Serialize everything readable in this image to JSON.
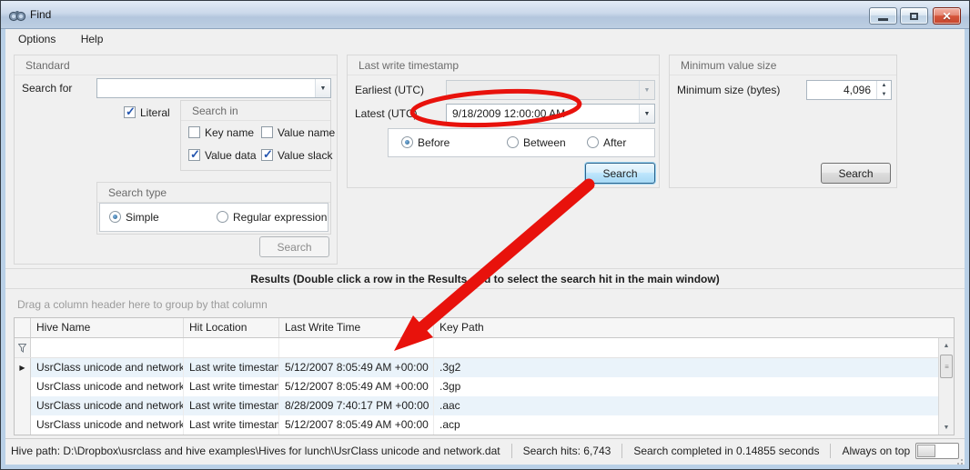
{
  "window": {
    "title": "Find"
  },
  "menu": {
    "options": "Options",
    "help": "Help"
  },
  "standard_group": {
    "title": "Standard",
    "search_for_label": "Search for",
    "search_for_value": "",
    "literal": {
      "label": "Literal",
      "checked": true
    },
    "search_in": {
      "title": "Search in",
      "options": [
        {
          "label": "Key name",
          "checked": false
        },
        {
          "label": "Value name",
          "checked": false
        },
        {
          "label": "Value data",
          "checked": true
        },
        {
          "label": "Value slack",
          "checked": true
        }
      ]
    },
    "search_type": {
      "title": "Search type",
      "options": [
        {
          "label": "Simple",
          "selected": true
        },
        {
          "label": "Regular expression",
          "selected": false
        }
      ]
    },
    "search_button": "Search"
  },
  "timestamp_group": {
    "title": "Last write timestamp",
    "earliest_label": "Earliest (UTC)",
    "earliest_value": "",
    "latest_label": "Latest (UTC)",
    "latest_value": "9/18/2009 12:00:00 AM",
    "range_options": [
      {
        "label": "Before",
        "selected": true
      },
      {
        "label": "Between",
        "selected": false
      },
      {
        "label": "After",
        "selected": false
      }
    ],
    "search_button": "Search"
  },
  "minsize_group": {
    "title": "Minimum value size",
    "size_label": "Minimum size (bytes)",
    "size_value": "4,096",
    "search_button": "Search"
  },
  "results": {
    "header": "Results (Double click a row in the Results grid to select the search hit in the main window)",
    "drag_hint": "Drag a column header here to group by that column",
    "columns": [
      "Hive Name",
      "Hit Location",
      "Last Write Time",
      "Key Path"
    ],
    "rows": [
      {
        "hive": "UsrClass unicode and network.dat",
        "hit": "Last write timestamp",
        "time": "5/12/2007 8:05:49 AM +00:00",
        "path": ".3g2",
        "selected": true
      },
      {
        "hive": "UsrClass unicode and network.dat",
        "hit": "Last write timestamp",
        "time": "5/12/2007 8:05:49 AM +00:00",
        "path": ".3gp",
        "selected": false
      },
      {
        "hive": "UsrClass unicode and network.dat",
        "hit": "Last write timestamp",
        "time": "8/28/2009 7:40:17 PM +00:00",
        "path": ".aac",
        "selected": false
      },
      {
        "hive": "UsrClass unicode and network.dat",
        "hit": "Last write timestamp",
        "time": "5/12/2007 8:05:49 AM +00:00",
        "path": ".acp",
        "selected": false
      }
    ]
  },
  "statusbar": {
    "hive_path": "Hive path: D:\\Dropbox\\usrclass and hive examples\\Hives for lunch\\UsrClass unicode and network.dat",
    "search_hits": "Search hits: 6,743",
    "completed": "Search completed in 0.14855 seconds",
    "always_on_top": "Always on top",
    "always_on_top_enabled": false
  },
  "icons": {
    "app": "binoculars",
    "minimize": "horizontal-bar",
    "maximize": "square",
    "close": "x",
    "dropdown": "▼",
    "spin_up": "▲",
    "spin_down": "▼",
    "selected_row": "▶",
    "filter_row": "funnel-pin",
    "scrollbar_up": "▲",
    "scrollbar_down": "▼"
  },
  "annotations": {
    "color": "#e8120c",
    "ellipse_around": "latest-utc-value",
    "arrow_from": "timestamp-search-button",
    "arrow_to": "results-grid"
  },
  "colors": {
    "titlebar_top": "#e3ecf6",
    "titlebar_bottom": "#b3c6dd",
    "frame": "#b9d0e7",
    "focus_button": "#a7d9f5",
    "alt_row": "#eaf3fa",
    "annotation_red": "#e8120c"
  }
}
